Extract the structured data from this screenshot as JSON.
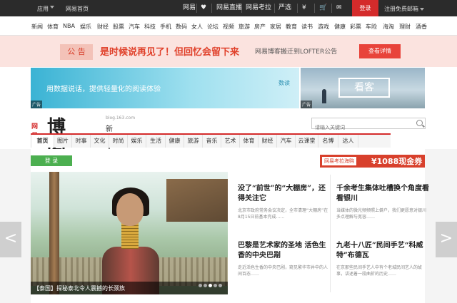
{
  "topbar": {
    "app_label": "应用",
    "home_label": "网易首页",
    "icons": [
      {
        "name": "phone-icon",
        "label": "网易"
      },
      {
        "name": "heart-icon",
        "label": "♥"
      },
      {
        "name": "lottery-icon",
        "label": "网易直播"
      },
      {
        "name": "exam-icon",
        "label": "网易考拉"
      },
      {
        "name": "product-icon",
        "label": "严选"
      },
      {
        "name": "finance-icon",
        "label": "¥"
      },
      {
        "name": "cart-icon",
        "label": "🛒"
      },
      {
        "name": "mail-icon",
        "label": "✉"
      }
    ],
    "login_label": "登录",
    "register_label": "注册免费邮箱"
  },
  "nav_items": [
    "新闻",
    "体育",
    "NBA",
    "娱乐",
    "财经",
    "股票",
    "汽车",
    "科技",
    "手机",
    "数码",
    "女人",
    "论坛",
    "视频",
    "旅游",
    "房产",
    "家居",
    "教育",
    "读书",
    "游戏",
    "健康",
    "彩票",
    "车险",
    "海淘",
    "理财",
    "酒香"
  ],
  "notice": {
    "tag": "公 告",
    "message": "是时候说再见了！但回忆会留下来",
    "sub": "网易博客搬迁到LOFTER公告",
    "button": "查看详情"
  },
  "banners": {
    "left_text": "用数据说话，提供轻量化的阅读体验",
    "left_logo": "数读",
    "right_text": "看客",
    "ad_label": "广告"
  },
  "brand": {
    "netease": "网易",
    "name": "博客",
    "domain": "blog.163.com",
    "slogan": "新锐人文生活"
  },
  "search": {
    "placeholder": "请输入关键词"
  },
  "tabs": [
    "首页",
    "图片",
    "时事",
    "文化",
    "时尚",
    "娱乐",
    "生活",
    "健康",
    "旅游",
    "音乐",
    "艺术",
    "体育",
    "财经",
    "汽车",
    "云课堂",
    "名博",
    "达人"
  ],
  "green_button": "登 录",
  "promo": {
    "tag": "网易考拉海购",
    "text": "¥1088现金券"
  },
  "hero": {
    "caption": "【泰国】探秘泰北令人震撼的长颈族"
  },
  "articles": [
    {
      "title": "没了“前世”的“大棚房”，还得关注它",
      "summary": "北京市政府常务会议决定，全市清理“大棚房”在8月15日前基本完成……"
    },
    {
      "title": "千余考生集体吐槽换个角度看看银川",
      "summary": "当媒体的微光频频照上僻户，我们更愿意对银川多点理解与宽容……"
    },
    {
      "title": "巴黎是艺术家的圣地 活色生香的中央巴剐",
      "summary": "走近活色生香的中央巴剐，窥见繁华市井中的人间百态……"
    },
    {
      "title": "九老十八匠”民间手艺“科威特”布德瓦",
      "summary": "在京那些民间手艺人中有个老城民间艺人的故事，讲述着一段曲折的历史……"
    }
  ],
  "arrows": {
    "left": "<",
    "right": ">"
  }
}
